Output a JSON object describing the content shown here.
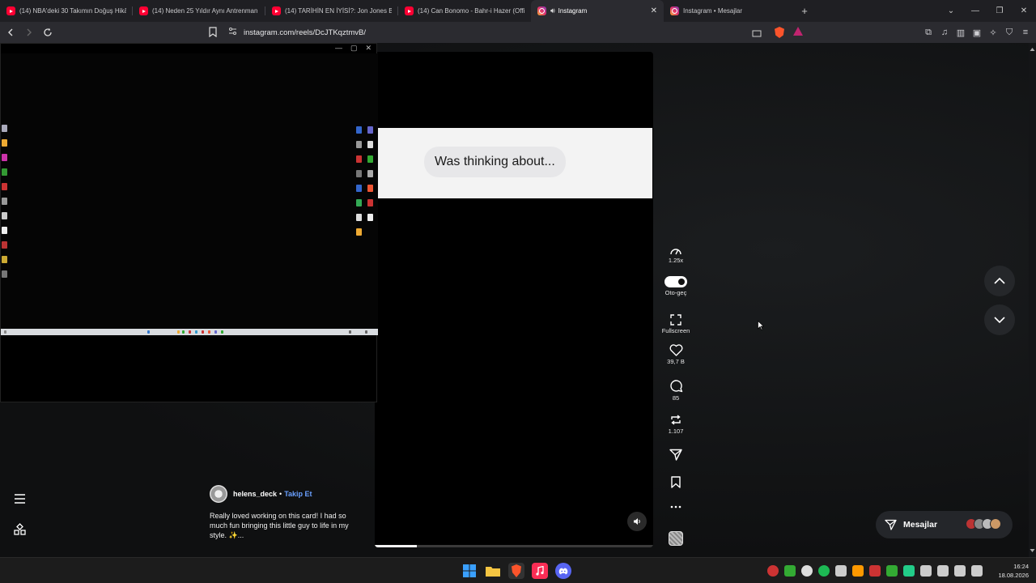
{
  "browser": {
    "tabs": [
      {
        "title": "(14) NBA'deki 30 Takımın Doğuş Hikâ",
        "favicon": "youtube",
        "active": false
      },
      {
        "title": "(14) Neden 25 Yıldır Aynı Antrenman",
        "favicon": "youtube",
        "active": false
      },
      {
        "title": "(14) TARİHİN EN İYİSİ?: Jon Jones Bel",
        "favicon": "youtube",
        "active": false
      },
      {
        "title": "(14) Can Bonomo - Bahr-i Hazer (Offi",
        "favicon": "youtube",
        "active": false
      },
      {
        "title": "Instagram",
        "favicon": "instagram",
        "active": true
      },
      {
        "title": "Instagram • Mesajlar",
        "favicon": "instagram",
        "active": false
      }
    ],
    "url": "instagram.com/reels/DcJTKqztmvB/"
  },
  "video": {
    "bubble_text": "Was thinking about...",
    "progress_fraction": 0.15
  },
  "actions": {
    "speed": "1.25x",
    "autoplay": "Oto-geç",
    "fullscreen": "Fullscreen",
    "likes": "39,7 B",
    "comments": "85",
    "reposts": "1.107"
  },
  "post": {
    "username": "helens_deck",
    "separator": "•",
    "follow": "Takip Et",
    "caption": "Really loved working on this card! I had so much fun bringing this little guy to life in my style. ✨..."
  },
  "messages": {
    "label": "Mesajlar"
  },
  "taskbar": {
    "time": "16:24",
    "date": "18.08.2026"
  },
  "colors": {
    "link_blue": "#6aa0ff",
    "youtube_red": "#ff0033",
    "page_bg": "#131416"
  }
}
